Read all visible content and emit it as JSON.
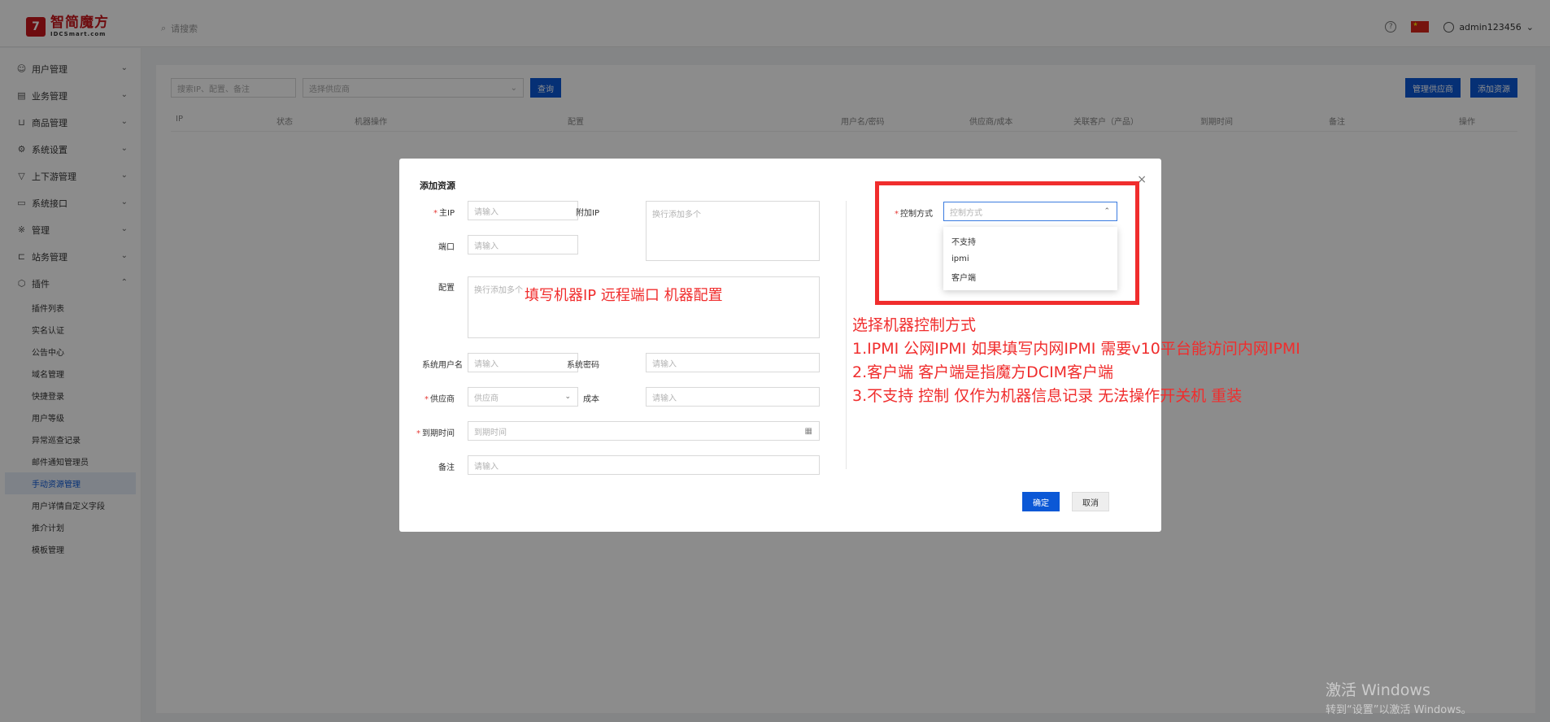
{
  "app": {
    "logo_mark": "7",
    "logo_name": "智简魔方",
    "logo_sub": "IDCSmart.com"
  },
  "header": {
    "search_placeholder": "请搜索",
    "help": "?",
    "user": "admin123456",
    "user_chev": "⌄"
  },
  "sidebar": {
    "items": [
      {
        "label": "用户管理",
        "icon": "☺"
      },
      {
        "label": "业务管理",
        "icon": "▤"
      },
      {
        "label": "商品管理",
        "icon": "⊔"
      },
      {
        "label": "系统设置",
        "icon": "⚙"
      },
      {
        "label": "上下游管理",
        "icon": "▽"
      },
      {
        "label": "系统接口",
        "icon": "▭"
      },
      {
        "label": "管理",
        "icon": "※"
      },
      {
        "label": "站务管理",
        "icon": "⊏"
      },
      {
        "label": "插件",
        "icon": "⬡"
      }
    ],
    "plugin_sub": [
      "插件列表",
      "实名认证",
      "公告中心",
      "域名管理",
      "快捷登录",
      "用户等级",
      "异常巡查记录",
      "邮件通知管理员",
      "手动资源管理",
      "用户详情自定义字段",
      "推介计划",
      "模板管理"
    ]
  },
  "list": {
    "search_placeholder": "搜索IP、配置、备注",
    "supplier_placeholder": "选择供应商",
    "query": "查询",
    "manage_supplier": "管理供应商",
    "add_resource": "添加资源",
    "columns": [
      "IP",
      "状态",
      "机器操作",
      "配置",
      "用户名/密码",
      "供应商/成本",
      "关联客户（产品）",
      "到期时间",
      "备注",
      "操作"
    ]
  },
  "modal": {
    "title": "添加资源",
    "close": "×",
    "main_ip_label": "主IP",
    "main_ip_ph": "请输入",
    "extra_ip_label": "附加IP",
    "extra_ip_ph": "换行添加多个",
    "port_label": "端口",
    "port_ph": "请输入",
    "config_label": "配置",
    "config_ph": "换行添加多个",
    "sys_user_label": "系统用户名",
    "sys_user_ph": "请输入",
    "sys_pwd_label": "系统密码",
    "sys_pwd_ph": "请输入",
    "supplier_label": "供应商",
    "supplier_ph": "供应商",
    "cost_label": "成本",
    "cost_ph": "请输入",
    "expire_label": "到期时间",
    "expire_ph": "到期时间",
    "note_label": "备注",
    "note_ph": "请输入",
    "control_label": "控制方式",
    "control_ph": "控制方式",
    "control_options": [
      "不支持",
      "ipmi",
      "客户端"
    ],
    "confirm": "确定",
    "cancel": "取消"
  },
  "annotations": {
    "config_hint": "填写机器IP 远程端口 机器配置",
    "control_title": "选择机器控制方式",
    "line1": "1.IPMI 公网IPMI  如果填写内网IPMI 需要v10平台能访问内网IPMI",
    "line2": "2.客户端  客户端是指魔方DCIM客户端",
    "line3": "3.不支持 控制  仅作为机器信息记录  无法操作开关机 重装"
  },
  "watermark": {
    "line1": "激活 Windows",
    "line2": "转到“设置”以激活 Windows。"
  },
  "colors": {
    "primary": "#0b58d6",
    "brand_red": "#c8161d",
    "annotation_red": "#f02d2d"
  }
}
